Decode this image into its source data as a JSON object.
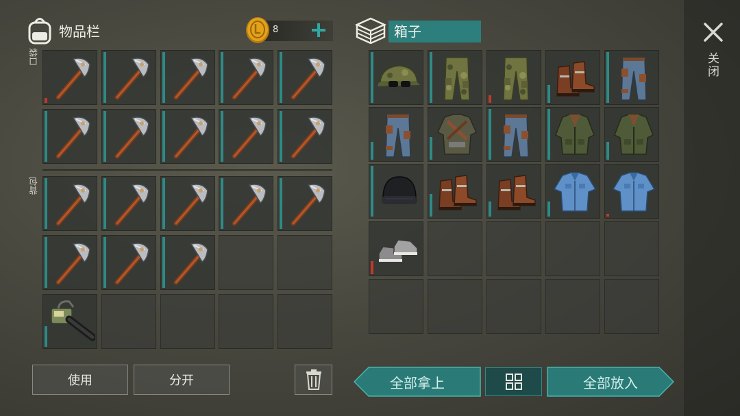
{
  "close": {
    "label": "关闭"
  },
  "inventory": {
    "title": "物品栏",
    "coins": "8",
    "pocket_label": "口袋",
    "backpack_label": "背包",
    "pocket_slots": [
      {
        "icon": "pickaxe",
        "durability": 0.1,
        "low": true
      },
      {
        "icon": "pickaxe",
        "durability": 1.0
      },
      {
        "icon": "pickaxe",
        "durability": 1.0
      },
      {
        "icon": "pickaxe",
        "durability": 1.0
      },
      {
        "icon": "pickaxe",
        "durability": 1.0
      },
      {
        "icon": "pickaxe",
        "durability": 1.0
      },
      {
        "icon": "pickaxe",
        "durability": 1.0
      },
      {
        "icon": "pickaxe",
        "durability": 1.0
      },
      {
        "icon": "pickaxe",
        "durability": 1.0
      },
      {
        "icon": "pickaxe",
        "durability": 1.0
      }
    ],
    "backpack_slots": [
      {
        "icon": "pickaxe",
        "durability": 1.0
      },
      {
        "icon": "pickaxe",
        "durability": 1.0
      },
      {
        "icon": "pickaxe",
        "durability": 1.0
      },
      {
        "icon": "pickaxe",
        "durability": 1.0
      },
      {
        "icon": "pickaxe",
        "durability": 1.0
      },
      {
        "icon": "pickaxe",
        "durability": 1.0
      },
      {
        "icon": "pickaxe",
        "durability": 1.0
      },
      {
        "icon": "pickaxe",
        "durability": 1.0
      },
      {
        "icon": "empty"
      },
      {
        "icon": "empty"
      },
      {
        "icon": "chainsaw",
        "durability": 0.4
      },
      {
        "icon": "empty"
      },
      {
        "icon": "empty"
      },
      {
        "icon": "empty"
      },
      {
        "icon": "empty"
      }
    ],
    "use_label": "使用",
    "split_label": "分开"
  },
  "box": {
    "title": "箱子",
    "slots": [
      {
        "icon": "camo-cap",
        "durability": 1.0
      },
      {
        "icon": "camo-pants",
        "durability": 1.0
      },
      {
        "icon": "camo-pants",
        "durability": 0.15,
        "low": true
      },
      {
        "icon": "leather-boots",
        "durability": 0.35
      },
      {
        "icon": "jeans",
        "durability": 1.0
      },
      {
        "icon": "jeans",
        "durability": 0.35
      },
      {
        "icon": "jacket-armored",
        "durability": 0.45
      },
      {
        "icon": "jeans",
        "durability": 1.0
      },
      {
        "icon": "green-jacket",
        "durability": 1.0
      },
      {
        "icon": "green-jacket",
        "durability": 0.35
      },
      {
        "icon": "beanie",
        "durability": 1.0
      },
      {
        "icon": "leather-boots",
        "durability": 0.45
      },
      {
        "icon": "leather-boots",
        "durability": 0.3
      },
      {
        "icon": "denim-shirt",
        "durability": 0.3
      },
      {
        "icon": "denim-shirt",
        "durability": 0.05,
        "low": true
      },
      {
        "icon": "sneakers",
        "durability": 0.25,
        "low": true
      },
      {
        "icon": "empty"
      },
      {
        "icon": "empty"
      },
      {
        "icon": "empty"
      },
      {
        "icon": "empty"
      },
      {
        "icon": "empty"
      },
      {
        "icon": "empty"
      },
      {
        "icon": "empty"
      },
      {
        "icon": "empty"
      },
      {
        "icon": "empty"
      }
    ],
    "take_all_label": "全部拿上",
    "put_all_label": "全部放入"
  },
  "colors": {
    "accent": "#2f8a86",
    "low": "#c0392b",
    "coin": "#e3a21a"
  }
}
